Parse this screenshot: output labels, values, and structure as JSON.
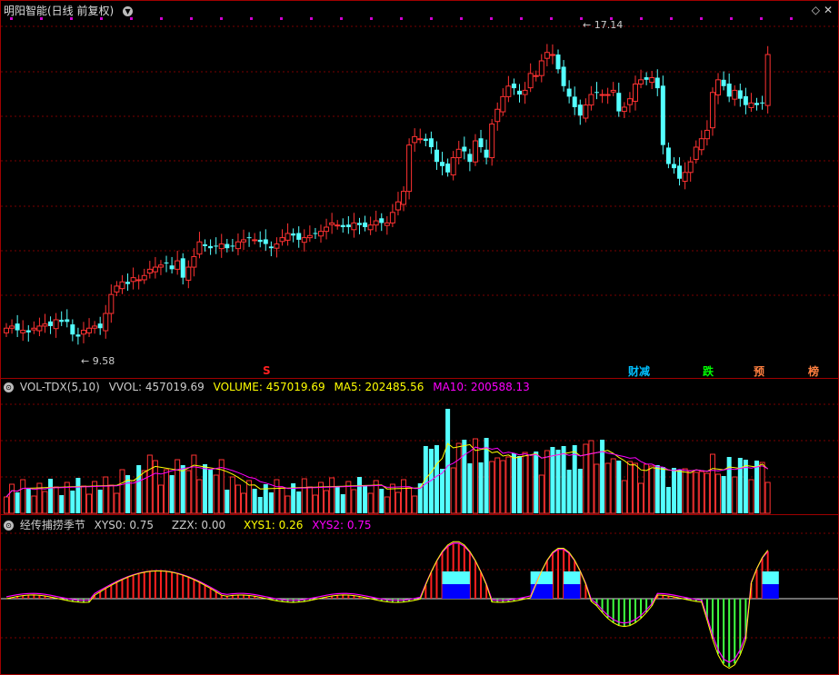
{
  "header": {
    "stock_title": "明阳智能(日线 前复权)",
    "menu_icon": "chevron-down-circle-icon",
    "corner_icons": [
      "diamond-icon",
      "close-icon"
    ]
  },
  "price_chart": {
    "high_label": "17.14",
    "low_label": "9.58",
    "signal_s": "S",
    "signals": [
      {
        "text": "财减",
        "color": "#00c0ff"
      },
      {
        "text": "跌",
        "color": "#00ff00"
      },
      {
        "text": "预",
        "color": "#ff8040"
      },
      {
        "text": "榜",
        "color": "#ff8040"
      }
    ]
  },
  "volume": {
    "label_name": "VOL-TDX(5,10)",
    "label_vvol": "VVOL: 457019.69",
    "label_volume": "VOLUME: 457019.69",
    "label_ma5": "MA5: 202485.56",
    "label_ma10": "MA10: 200588.13",
    "colors": {
      "volume": "#ffff00",
      "ma5": "#ffff00",
      "ma10": "#ff00ff",
      "vvol": "#cccccc"
    }
  },
  "indicator": {
    "label_name": "经传捕捞季节",
    "label_xys0": "XYS0: 0.75",
    "label_zzx": "ZZX: 0.00",
    "label_xys1": "XYS1: 0.26",
    "label_xys2": "XYS2: 0.75",
    "colors": {
      "xys0": "#cccccc",
      "zzx": "#cccccc",
      "xys1": "#ffff00",
      "xys2": "#ff00ff"
    }
  },
  "chart_data": {
    "type": "candlestick",
    "price_high": 17.14,
    "price_low": 9.58,
    "closes": [
      10.05,
      10.1,
      10.0,
      10.0,
      9.95,
      10.05,
      10.1,
      10.15,
      10.1,
      10.25,
      10.2,
      10.2,
      9.9,
      9.85,
      10.0,
      10.05,
      10.1,
      10.05,
      10.4,
      10.85,
      11.05,
      11.15,
      11.1,
      11.25,
      11.2,
      11.3,
      11.45,
      11.5,
      11.55,
      11.6,
      11.45,
      11.65,
      11.25,
      11.5,
      11.75,
      12.1,
      12.0,
      11.95,
      12.0,
      12.05,
      11.95,
      12.0,
      12.1,
      12.15,
      12.2,
      12.15,
      12.1,
      12.05,
      11.95,
      12.05,
      12.2,
      12.3,
      12.25,
      12.15,
      12.2,
      12.25,
      12.3,
      12.35,
      12.45,
      12.55,
      12.5,
      12.45,
      12.45,
      12.55,
      12.5,
      12.45,
      12.5,
      12.6,
      12.55,
      12.55,
      12.8,
      13.05,
      13.3,
      14.4,
      14.6,
      14.55,
      14.5,
      14.35,
      14.0,
      13.9,
      13.75,
      14.1,
      14.3,
      14.25,
      14.0,
      14.5,
      14.35,
      14.1,
      14.9,
      15.25,
      15.55,
      15.8,
      15.75,
      15.6,
      15.7,
      16.1,
      16.05,
      16.4,
      16.6,
      16.55,
      16.2,
      15.8,
      15.55,
      15.3,
      15.1,
      15.35,
      15.6,
      15.65,
      15.6,
      15.6,
      15.7,
      15.2,
      15.3,
      15.5,
      15.85,
      15.95,
      15.95,
      16.0,
      15.75,
      14.4,
      13.95,
      13.85,
      13.6,
      13.75,
      14.0,
      14.35,
      14.55,
      14.75,
      15.65,
      15.95,
      15.8,
      15.55,
      15.7,
      15.5,
      15.35,
      15.4,
      15.35,
      15.4,
      16.55
    ]
  }
}
